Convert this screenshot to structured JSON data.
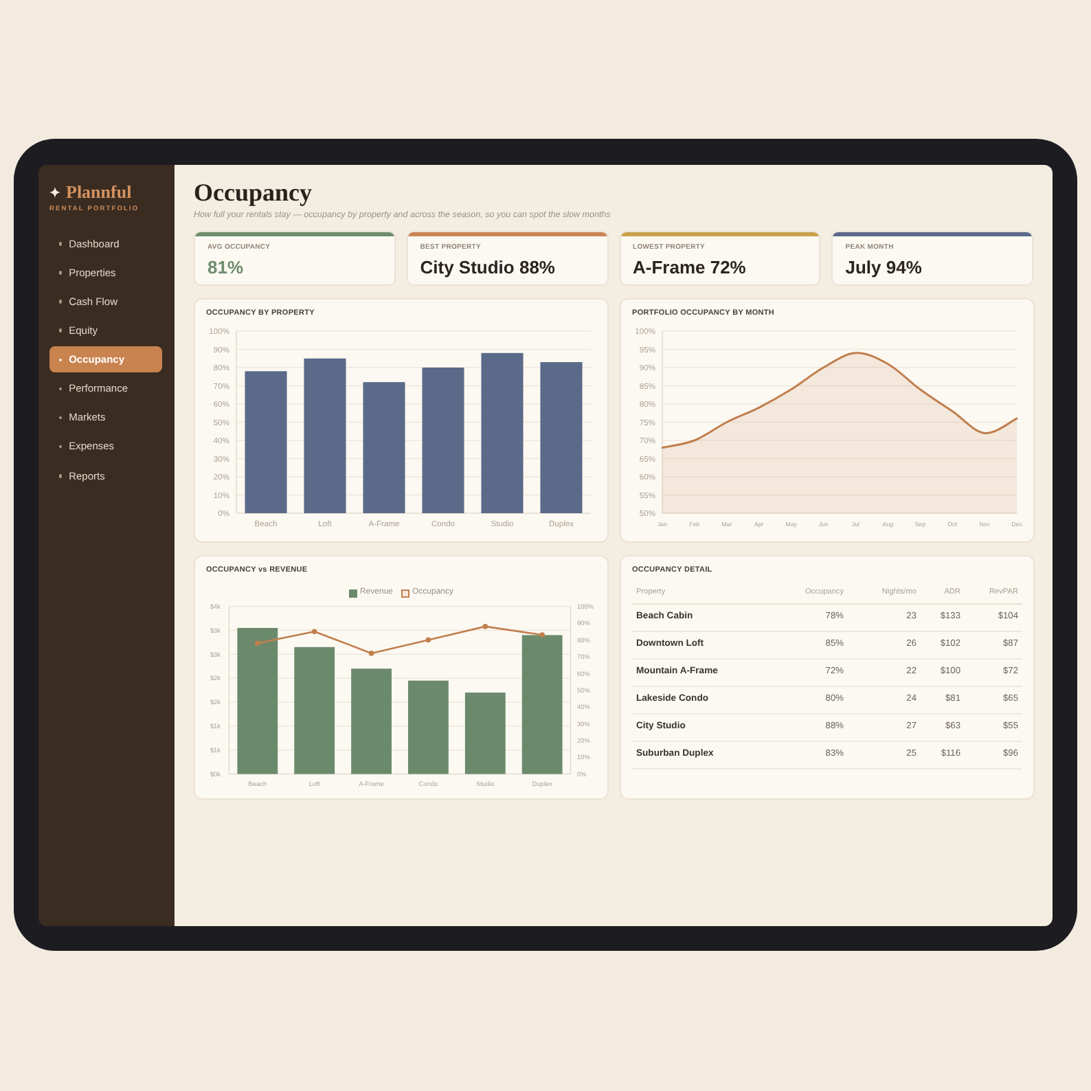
{
  "sidebar": {
    "brand": "Plannful",
    "tagline": "RENTAL PORTFOLIO",
    "items": [
      {
        "label": "Dashboard",
        "selected": false
      },
      {
        "label": "Properties",
        "selected": false
      },
      {
        "label": "Cash Flow",
        "selected": false
      },
      {
        "label": "Equity",
        "selected": false
      },
      {
        "label": "Occupancy",
        "selected": true
      },
      {
        "label": "Performance",
        "selected": false
      },
      {
        "label": "Markets",
        "selected": false
      },
      {
        "label": "Expenses",
        "selected": false
      },
      {
        "label": "Reports",
        "selected": false
      }
    ]
  },
  "header": {
    "title": "Occupancy",
    "subtitle": "How full your rentals stay — occupancy by property and across the season, so you can spot the slow months"
  },
  "kpis": [
    {
      "label": "AVG OCCUPANCY",
      "value": "81%",
      "color": "#6e8c6c",
      "value_tinted": true
    },
    {
      "label": "BEST PROPERTY",
      "value": "City Studio 88%",
      "color": "#c98555",
      "value_tinted": false
    },
    {
      "label": "LOWEST PROPERTY",
      "value": "A-Frame 72%",
      "color": "#c9a14c",
      "value_tinted": false
    },
    {
      "label": "PEAK MONTH",
      "value": "July 94%",
      "color": "#5b6b8a",
      "value_tinted": false
    }
  ],
  "panels": [
    {
      "kind": "chart",
      "chart_data": {
        "type": "bar",
        "title": "OCCUPANCY BY PROPERTY",
        "categories": [
          "Beach",
          "Loft",
          "A-Frame",
          "Condo",
          "Studio",
          "Duplex"
        ],
        "values": [
          78,
          85,
          72,
          80,
          88,
          83
        ],
        "ylim": [
          0,
          100
        ],
        "yticks": [
          {
            "value": 0,
            "label": "0%"
          },
          {
            "value": 10,
            "label": "10%"
          },
          {
            "value": 20,
            "label": "20%"
          },
          {
            "value": 30,
            "label": "30%"
          },
          {
            "value": 40,
            "label": "40%"
          },
          {
            "value": 50,
            "label": "50%"
          },
          {
            "value": 60,
            "label": "60%"
          },
          {
            "value": 70,
            "label": "70%"
          },
          {
            "value": 80,
            "label": "80%"
          },
          {
            "value": 90,
            "label": "90%"
          },
          {
            "value": 100,
            "label": "100%"
          }
        ],
        "grid": true
      }
    },
    {
      "kind": "chart",
      "chart_data": {
        "type": "area",
        "title": "PORTFOLIO OCCUPANCY BY MONTH",
        "categories": [
          "Jan",
          "Feb",
          "Mar",
          "Apr",
          "May",
          "Jun",
          "Jul",
          "Aug",
          "Sep",
          "Oct",
          "Nov",
          "Dec"
        ],
        "values": [
          68,
          70,
          75,
          79,
          84,
          90,
          94,
          91,
          84,
          78,
          72,
          76
        ],
        "ylim": [
          50,
          100
        ],
        "yticks": [
          {
            "value": 50,
            "label": "50%"
          },
          {
            "value": 55,
            "label": "55%"
          },
          {
            "value": 60,
            "label": "60%"
          },
          {
            "value": 65,
            "label": "65%"
          },
          {
            "value": 70,
            "label": "70%"
          },
          {
            "value": 75,
            "label": "75%"
          },
          {
            "value": 80,
            "label": "80%"
          },
          {
            "value": 85,
            "label": "85%"
          },
          {
            "value": 90,
            "label": "90%"
          },
          {
            "value": 95,
            "label": "95%"
          },
          {
            "value": 100,
            "label": "100%"
          }
        ],
        "grid": true
      }
    },
    {
      "kind": "chart",
      "chart_data": {
        "type": "bar",
        "title": "OCCUPANCY vs REVENUE",
        "categories": [
          "Beach",
          "Loft",
          "A-Frame",
          "Condo",
          "Studio",
          "Duplex"
        ],
        "series": [
          {
            "name": "Revenue",
            "color": "#6b8a6b",
            "values": [
              3050,
              2650,
              2200,
              1950,
              1700,
              2900
            ]
          },
          {
            "name": "Occupancy",
            "type": "line",
            "axis": "y2",
            "marker": "circle",
            "color": "#c17f4e",
            "values": [
              78,
              85,
              72,
              80,
              88,
              83
            ]
          }
        ],
        "ylim": [
          0,
          3500
        ],
        "yticks": [
          {
            "value": 0,
            "label": "$0k"
          },
          {
            "value": 500,
            "label": "$1k"
          },
          {
            "value": 1000,
            "label": "$1k"
          },
          {
            "value": 1500,
            "label": "$2k"
          },
          {
            "value": 2000,
            "label": "$2k"
          },
          {
            "value": 2500,
            "label": "$3k"
          },
          {
            "value": 3000,
            "label": "$3k"
          },
          {
            "value": 3500,
            "label": "$4k"
          }
        ],
        "y2lim": [
          0,
          100
        ],
        "y2ticks": [
          {
            "value": 0,
            "label": "0%"
          },
          {
            "value": 10,
            "label": "10%"
          },
          {
            "value": 20,
            "label": "20%"
          },
          {
            "value": 30,
            "label": "30%"
          },
          {
            "value": 40,
            "label": "40%"
          },
          {
            "value": 50,
            "label": "50%"
          },
          {
            "value": 60,
            "label": "60%"
          },
          {
            "value": 70,
            "label": "70%"
          },
          {
            "value": 80,
            "label": "80%"
          },
          {
            "value": 90,
            "label": "90%"
          },
          {
            "value": 100,
            "label": "100%"
          }
        ],
        "grid": true,
        "legend": "top"
      }
    },
    {
      "kind": "table",
      "title": "OCCUPANCY DETAIL",
      "columns": [
        "Property",
        "Occupancy",
        "Nights/mo",
        "ADR",
        "RevPAR"
      ],
      "rows": [
        [
          "Beach Cabin",
          "78%",
          "23",
          "$133",
          "$104"
        ],
        [
          "Downtown Loft",
          "85%",
          "26",
          "$102",
          "$87"
        ],
        [
          "Mountain A-Frame",
          "72%",
          "22",
          "$100",
          "$72"
        ],
        [
          "Lakeside Condo",
          "80%",
          "24",
          "$81",
          "$65"
        ],
        [
          "City Studio",
          "88%",
          "27",
          "$63",
          "$55"
        ],
        [
          "Suburban Duplex",
          "83%",
          "25",
          "$116",
          "$96"
        ]
      ]
    }
  ]
}
